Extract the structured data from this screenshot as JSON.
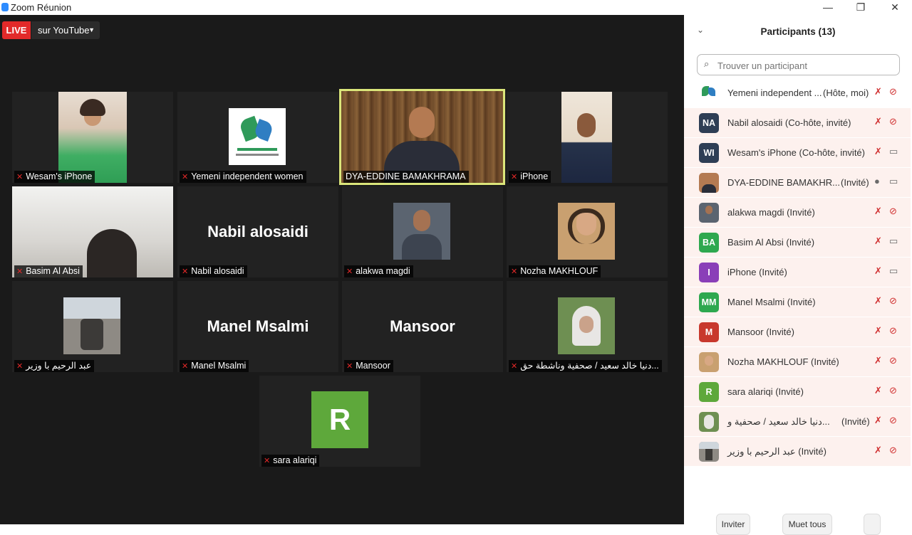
{
  "window": {
    "title": "Zoom Réunion"
  },
  "stream": {
    "live_label": "LIVE",
    "destination_label": "sur YouTube"
  },
  "tiles": [
    {
      "name": "Wesam's iPhone"
    },
    {
      "name": "Yemeni independent women"
    },
    {
      "name": "DYA-EDDINE BAMAKHRAMA"
    },
    {
      "name": "iPhone"
    },
    {
      "name": "Basim Al Absi"
    },
    {
      "name": "Nabil alosaidi",
      "display": "Nabil alosaidi"
    },
    {
      "name": "alakwa magdi"
    },
    {
      "name": "Nozha MAKHLOUF"
    },
    {
      "name": "عبد الرحيم با وزير"
    },
    {
      "name": "Manel Msalmi",
      "display": "Manel Msalmi"
    },
    {
      "name": "Mansoor",
      "display": "Mansoor"
    },
    {
      "name": "دنيا خالد سعيد / صحفية وناشطة حق..."
    },
    {
      "name": "sara alariqi",
      "letter": "R"
    }
  ],
  "panel": {
    "title": "Participants (13)",
    "search_placeholder": "Trouver un participant",
    "participants": [
      {
        "name": "Yemeni independent ...",
        "role": "(Hôte, moi)",
        "avatar": ""
      },
      {
        "name": "Nabil alosaidi (Co-hôte, invité)",
        "role": "",
        "avatar": "NA",
        "color": "#2e3e55"
      },
      {
        "name": "Wesam's iPhone (Co-hôte, invité)",
        "role": "",
        "avatar": "WI",
        "color": "#2e3e55"
      },
      {
        "name": "DYA-EDDINE BAMAKHR...",
        "role": "(Invité)",
        "avatar": ""
      },
      {
        "name": "alakwa magdi (Invité)",
        "role": "",
        "avatar": ""
      },
      {
        "name": "Basim Al Absi (Invité)",
        "role": "",
        "avatar": "BA",
        "color": "#2ea84f"
      },
      {
        "name": "iPhone (Invité)",
        "role": "",
        "avatar": "I",
        "color": "#8a3fb8"
      },
      {
        "name": "Manel Msalmi (Invité)",
        "role": "",
        "avatar": "MM",
        "color": "#2ea84f"
      },
      {
        "name": "Mansoor (Invité)",
        "role": "",
        "avatar": "M",
        "color": "#c8382d"
      },
      {
        "name": "Nozha MAKHLOUF (Invité)",
        "role": "",
        "avatar": ""
      },
      {
        "name": "sara alariqi (Invité)",
        "role": "",
        "avatar": "R",
        "color": "#5ea83b"
      },
      {
        "name": "دنيا خالد سعيد / صحفية و...",
        "role": "(Invité)",
        "avatar": ""
      },
      {
        "name": "عبد الرحيم با وزير (Invité)",
        "role": "",
        "avatar": ""
      }
    ],
    "footer": {
      "invite": "Inviter",
      "mute_all": "Muet tous"
    }
  },
  "colors": {
    "live": "#e22a2a",
    "active_border": "#dbe67a",
    "muted": "#d03030"
  }
}
